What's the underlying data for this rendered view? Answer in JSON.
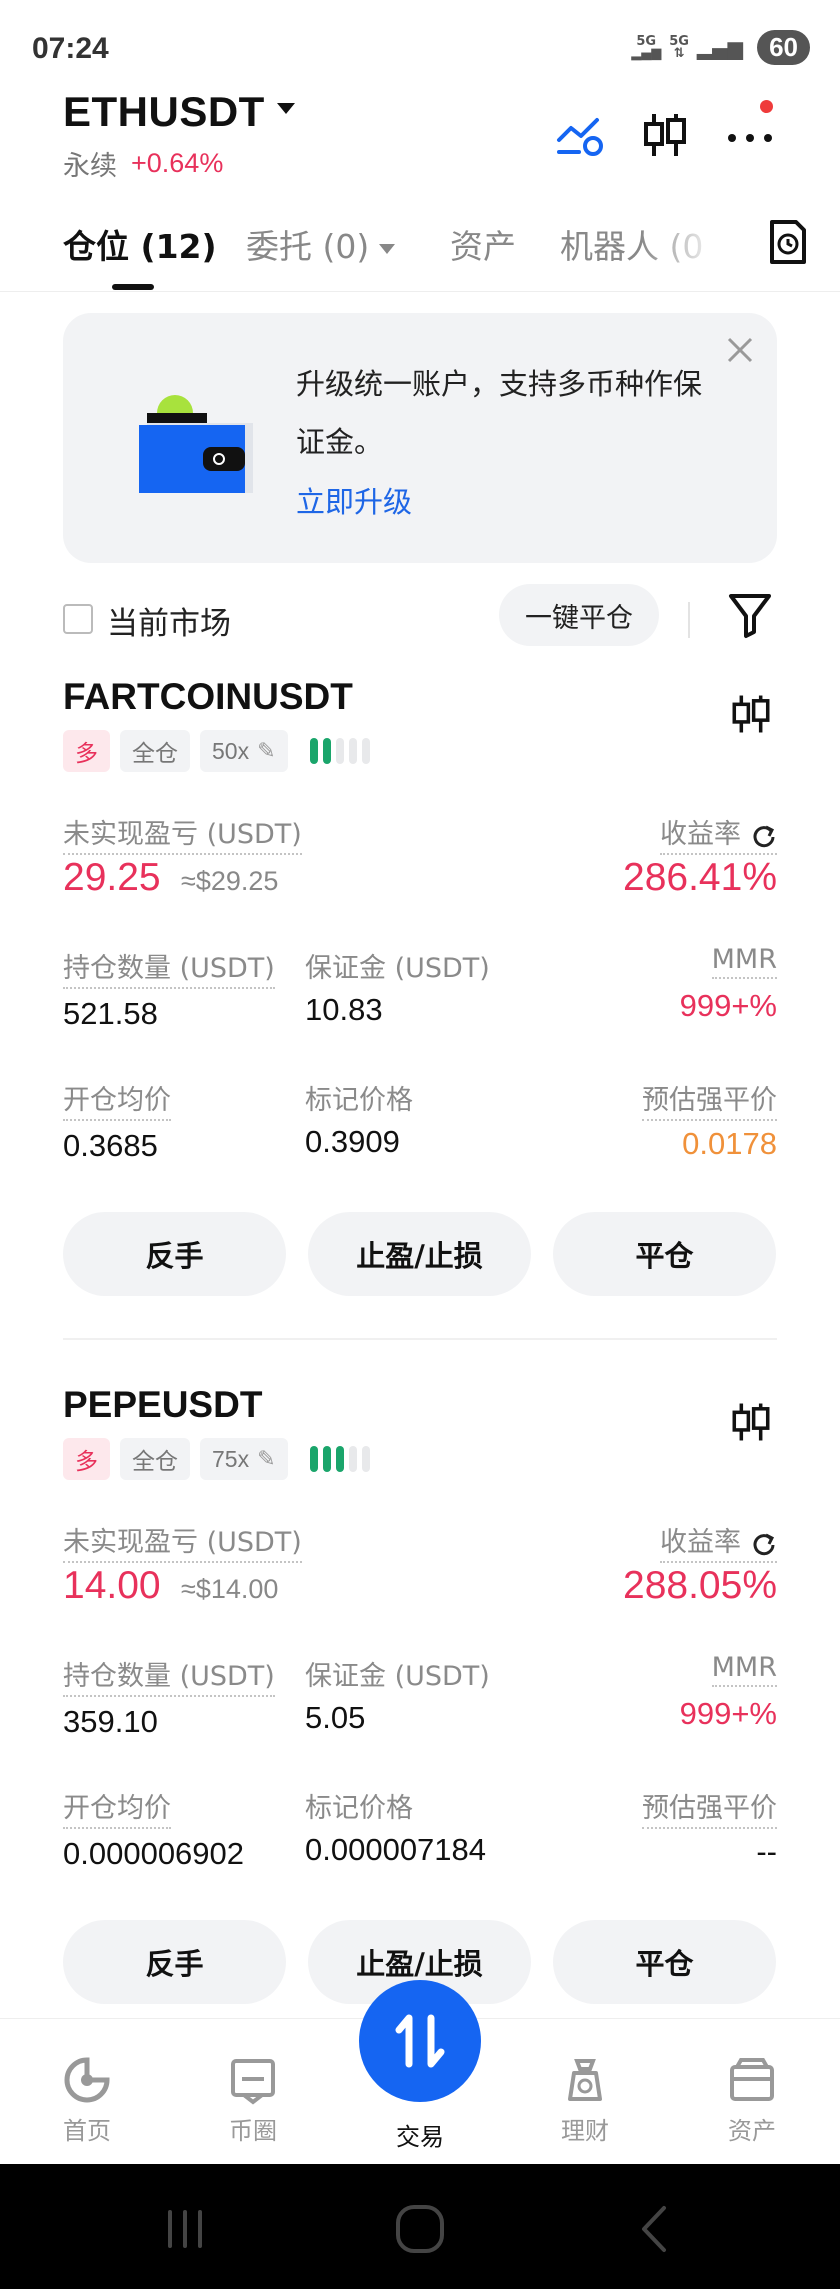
{
  "status_bar": {
    "time": "07:24",
    "network1": "5G",
    "network2": "5G",
    "battery": "60"
  },
  "header": {
    "symbol": "ETHUSDT",
    "contract_type": "永续",
    "change_pct": "+0.64%",
    "change_color": "#e8315b",
    "icons": [
      "strategy-chart-icon",
      "candlestick-icon",
      "more-icon"
    ]
  },
  "tabs": [
    {
      "label": "仓位 (12)",
      "active": true
    },
    {
      "label": "委托 (0)",
      "active": false
    },
    {
      "label": "资产",
      "active": false
    },
    {
      "label": "机器人 (0",
      "active": false
    }
  ],
  "banner": {
    "text": "升级统一账户，支持多币种作保证金。",
    "link": "立即升级"
  },
  "filter": {
    "current_market_label": "当前市场",
    "current_market_checked": false,
    "close_all_label": "一键平仓"
  },
  "labels": {
    "unrealized_pnl": "未实现盈亏 (USDT)",
    "roe": "收益率",
    "position_size": "持仓数量 (USDT)",
    "margin": "保证金 (USDT)",
    "mmr": "MMR",
    "entry_price": "开仓均价",
    "mark_price": "标记价格",
    "liq_price": "预估强平价"
  },
  "positions": [
    {
      "symbol": "FARTCOINUSDT",
      "side": "多",
      "margin_mode": "全仓",
      "leverage": "50x",
      "adl_level": 2,
      "unrealized_pnl": "29.25",
      "pnl_usd": "≈$29.25",
      "roe": "286.41%",
      "position_size": "521.58",
      "margin": "10.83",
      "mmr": "999+%",
      "entry_price": "0.3685",
      "mark_price": "0.3909",
      "liq_price": "0.0178",
      "actions": [
        "反手",
        "止盈/止损",
        "平仓"
      ]
    },
    {
      "symbol": "PEPEUSDT",
      "side": "多",
      "margin_mode": "全仓",
      "leverage": "75x",
      "adl_level": 3,
      "unrealized_pnl": "14.00",
      "pnl_usd": "≈$14.00",
      "roe": "288.05%",
      "position_size": "359.10",
      "margin": "5.05",
      "mmr": "999+%",
      "entry_price": "0.000006902",
      "mark_price": "0.000007184",
      "liq_price": "--",
      "actions": [
        "反手",
        "止盈/止损",
        "平仓"
      ]
    }
  ],
  "bottom_nav": [
    {
      "label": "首页",
      "icon": "home-icon",
      "active": false
    },
    {
      "label": "币圈",
      "icon": "feed-icon",
      "active": false
    },
    {
      "label": "交易",
      "icon": "trade-icon",
      "active": true
    },
    {
      "label": "理财",
      "icon": "finance-icon",
      "active": false
    },
    {
      "label": "资产",
      "icon": "wallet-icon",
      "active": false
    }
  ],
  "colors": {
    "accent": "#1565f2",
    "profit": "#e8315b",
    "warning": "#f0913a",
    "adl_on": "#1aa56b"
  }
}
